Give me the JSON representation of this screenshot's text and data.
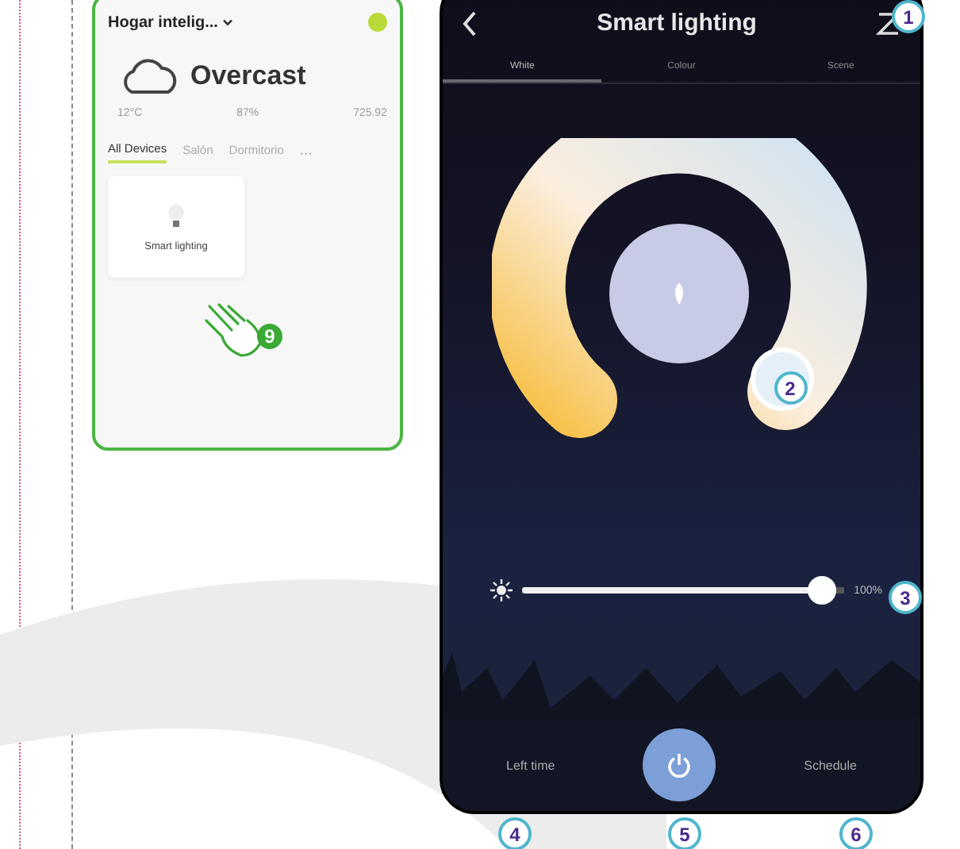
{
  "home_screen": {
    "home_name": "Hogar intelig...",
    "weather": {
      "condition": "Overcast",
      "stats": [
        "12°C",
        "87%",
        "725.92"
      ]
    },
    "tabs": [
      {
        "label": "All Devices",
        "selected": true
      },
      {
        "label": "Salón",
        "selected": false
      },
      {
        "label": "Dormitorio",
        "selected": false
      }
    ],
    "more": "···",
    "devices": [
      {
        "name": "Smart lighting"
      }
    ]
  },
  "light_screen": {
    "title": "Smart lighting",
    "tabs": [
      {
        "label": "White",
        "selected": true
      },
      {
        "label": "Colour",
        "selected": false
      },
      {
        "label": "Scene",
        "selected": false
      }
    ],
    "brightness": {
      "level": 0.97,
      "reading": "100%"
    },
    "power": {
      "on": true
    },
    "left_label": "Left time",
    "right_label": "Schedule"
  },
  "callouts": {
    "edit": "1",
    "ring": "2",
    "slider": "3",
    "timer": "4",
    "power": "5",
    "schedule": "6",
    "tap": "9"
  }
}
